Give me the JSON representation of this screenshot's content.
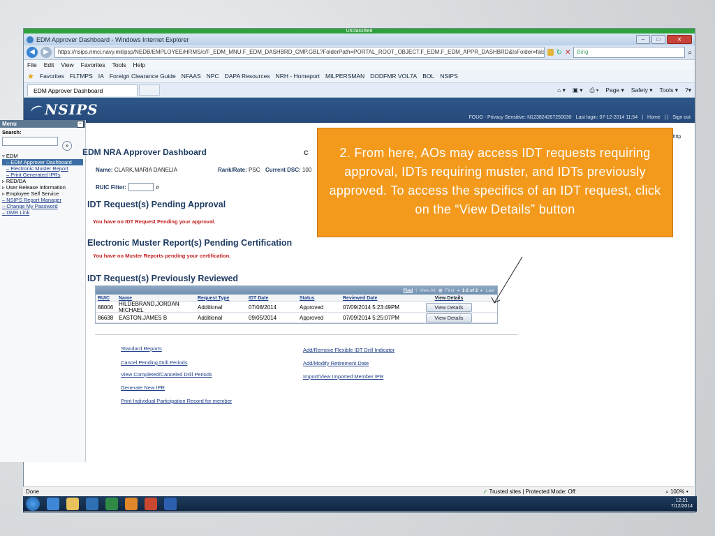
{
  "classification": "Unclassified",
  "window_title": "EDM Approver Dashboard - Windows Internet Explorer",
  "address_url": "https://nsips.nmci.navy.mil/psp/NEDB/EMPLOYEE/HRMS/c/F_EDM_MNU.F_EDM_DASHBRD_CMP.GBL?FolderPath=PORTAL_ROOT_OBJECT.F_EDM.F_EDM_APPR_DASHBRD&IsFolder=false&IgnoreParamTempl=FolderPath",
  "search_placeholder": "Bing",
  "menu_items": [
    "File",
    "Edit",
    "View",
    "Favorites",
    "Tools",
    "Help"
  ],
  "favorites": [
    "Favorites",
    "FLTMPS",
    "IA",
    "Foreign Clearance Guide",
    "NFAAS",
    "NPC",
    "DAPA Resources",
    "NRH - Homeport",
    "MILPERSMAN",
    "DODFMR VOL7A",
    "BOL",
    "NSIPS"
  ],
  "tab_title": "EDM Approver Dashboard",
  "command_bar": [
    "Page ▾",
    "Safety ▾",
    "Tools ▾"
  ],
  "nsips_logo": "NSIPS",
  "header_links": [
    "FOUO - Privacy Sensitive: N123824267250030",
    "Last login: 07-12-2014 11:54",
    "Home",
    "Sign out"
  ],
  "sidebar": {
    "title": "Menu",
    "search_label": "Search:",
    "items": [
      "EDM",
      "EDM Approver Dashboard",
      "Electronic Muster Report",
      "Print Generated IPRs",
      "RED/DA",
      "User Release Information",
      "Employee Self Service",
      "NSIPS Report Manager",
      "Change My Password",
      "DMR Link"
    ]
  },
  "main": {
    "title": "EDM NRA Approver Dashboard",
    "c_button": "C",
    "name_label": "Name:",
    "name_value": "CLARK,MARIA DANELIA",
    "rank_label": "Rank/Rate:",
    "rank_value": "PSC",
    "dsc_label": "Current DSC:",
    "dsc_value": "100",
    "ruic_label": "RUIC Filter:",
    "pending_title": "IDT Request(s) Pending Approval",
    "pending_msg": "You have no IDT Request Pending your approval.",
    "muster_title": "Electronic Muster Report(s) Pending Certification",
    "muster_msg": "You have no Muster Reports pending your certification.",
    "reviewed_title": "IDT Request(s) Previously Reviewed",
    "grid_nav": [
      "Find",
      "View All",
      "First",
      "1-2 of 2",
      "Last"
    ],
    "columns": [
      "RUIC",
      "Name",
      "Request Type",
      "IDT Date",
      "Status",
      "Reviewed Date",
      "View Details"
    ],
    "rows": [
      [
        "88006",
        "HILDEBRAND,JORDAN MICHAEL",
        "Additional",
        "07/08/2014",
        "Approved",
        "07/09/2014  5:23:49PM",
        "View Details"
      ],
      [
        "86638",
        "EASTON,JAMES B",
        "Additional",
        "09/05/2014",
        "Approved",
        "07/09/2014  5:25:07PM",
        "View Details"
      ]
    ],
    "links_left": [
      "Standard Reports",
      "Cancel Pending Drill Periods",
      "View Completed/Canceled Drill Periods",
      "Generate New IPR",
      "Print Individual Participation Record for member"
    ],
    "links_right": [
      "Add/Remove Flexible IDT Drill Indicator",
      "Add/Modify Retirement Date",
      "Import/View Imported Member IPR"
    ]
  },
  "http_label": "http",
  "status_text": "Done",
  "trusted_text": "Trusted sites | Protected Mode: Off",
  "zoom_text": "100%",
  "clock_time": "12:21",
  "clock_date": "7/12/2014",
  "callout_text": "2.  From here, AOs may access IDT requests requiring approval, IDTs requiring muster, and IDTs previously approved.  To access the specifics of an IDT request, click on the “View Details” button",
  "colors": {
    "callout": "#f39a1d",
    "header": "#26497a",
    "title_text": "#1f3c63",
    "error_text": "#c21d1d"
  }
}
